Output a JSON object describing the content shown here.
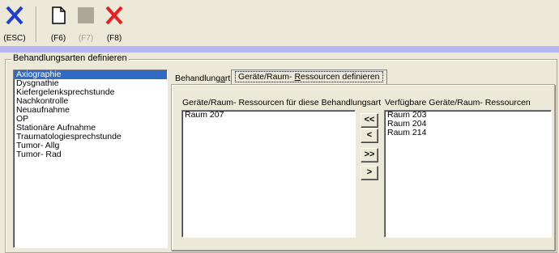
{
  "toolbar": {
    "buttons": [
      {
        "label": "(ESC)",
        "icon": "close-x-blue-icon",
        "enabled": true
      },
      {
        "label": "(F6)",
        "icon": "new-document-icon",
        "enabled": true
      },
      {
        "label": "(F7)",
        "icon": "save-disabled-icon",
        "enabled": false
      },
      {
        "label": "(F8)",
        "icon": "delete-x-red-icon",
        "enabled": true
      }
    ]
  },
  "group": {
    "title": "Behandlungsarten definieren"
  },
  "treatments": {
    "items": [
      "Axiographie",
      "Dysgnathie",
      "Kiefergelenksprechstunde",
      "Nachkontrolle",
      "Neuaufnahme",
      "OP",
      "Stationäre Aufnahme",
      "Traumatologiesprechstunde",
      "Tumor- Allg",
      "Tumor- Rad"
    ],
    "selected": "Axiographie"
  },
  "tabs": {
    "tab1": {
      "pre": "Behandlung",
      "accel": "a",
      "post": "rt"
    },
    "tab2": {
      "pre": "Geräte/Raum- ",
      "accel": "R",
      "post": "essourcen definieren"
    }
  },
  "assigned": {
    "label": "Geräte/Raum- Ressourcen für diese Behandlungsart",
    "items": [
      "Raum 207"
    ]
  },
  "available": {
    "label": "Verfügbare Geräte/Raum- Ressourcen",
    "items": [
      "Raum 203",
      "Raum 204",
      "Raum 214"
    ]
  },
  "transfer_buttons": {
    "all_left": "<<",
    "one_left": "<",
    "all_right": ">>",
    "one_right": ">"
  }
}
